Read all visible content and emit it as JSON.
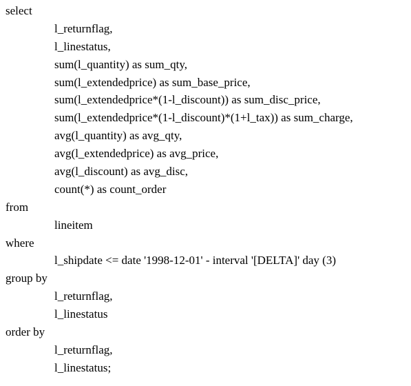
{
  "query": {
    "lines": [
      {
        "text": "select",
        "indent": 0
      },
      {
        "text": "l_returnflag,",
        "indent": 1
      },
      {
        "text": "l_linestatus,",
        "indent": 1
      },
      {
        "text": "sum(l_quantity) as sum_qty,",
        "indent": 1
      },
      {
        "text": "sum(l_extendedprice) as sum_base_price,",
        "indent": 1
      },
      {
        "text": "sum(l_extendedprice*(1-l_discount)) as sum_disc_price,",
        "indent": 1
      },
      {
        "text": "sum(l_extendedprice*(1-l_discount)*(1+l_tax)) as sum_charge,",
        "indent": 1
      },
      {
        "text": "avg(l_quantity) as avg_qty,",
        "indent": 1
      },
      {
        "text": "avg(l_extendedprice) as avg_price,",
        "indent": 1
      },
      {
        "text": "avg(l_discount) as avg_disc,",
        "indent": 1
      },
      {
        "text": "count(*) as count_order",
        "indent": 1
      },
      {
        "text": "from",
        "indent": 0
      },
      {
        "text": "lineitem",
        "indent": 1
      },
      {
        "text": "where",
        "indent": 0
      },
      {
        "text": "l_shipdate <= date '1998-12-01' - interval '[DELTA]' day (3)",
        "indent": 1
      },
      {
        "text": "group by",
        "indent": 0
      },
      {
        "text": "l_returnflag,",
        "indent": 1
      },
      {
        "text": "l_linestatus",
        "indent": 1
      },
      {
        "text": "order by",
        "indent": 0
      },
      {
        "text": "l_returnflag,",
        "indent": 1
      },
      {
        "text": "l_linestatus;",
        "indent": 1
      }
    ]
  }
}
